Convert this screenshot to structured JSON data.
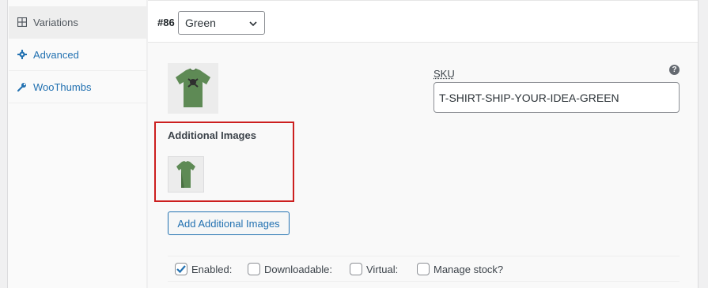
{
  "sidebar": {
    "items": [
      {
        "label": "Variations",
        "icon": "grid-icon",
        "active": true
      },
      {
        "label": "Advanced",
        "icon": "gear-icon",
        "active": false
      },
      {
        "label": "WooThumbs",
        "icon": "wrench-icon",
        "active": false
      }
    ]
  },
  "variation": {
    "number": "#86",
    "selected": "Green"
  },
  "sku": {
    "label": "SKU",
    "value": "T-SHIRT-SHIP-YOUR-IDEA-GREEN",
    "help": "?"
  },
  "additional_images": {
    "title": "Additional Images",
    "button_label": "Add Additional Images"
  },
  "options": {
    "enabled": {
      "label": "Enabled:",
      "checked": true
    },
    "downloadable": {
      "label": "Downloadable:",
      "checked": false
    },
    "virtual": {
      "label": "Virtual:",
      "checked": false
    },
    "manage_stock": {
      "label": "Manage stock?",
      "checked": false
    }
  },
  "colors": {
    "accent": "#2271b1",
    "highlight": "#cc1f1f",
    "shirt": "#5e8a55"
  }
}
